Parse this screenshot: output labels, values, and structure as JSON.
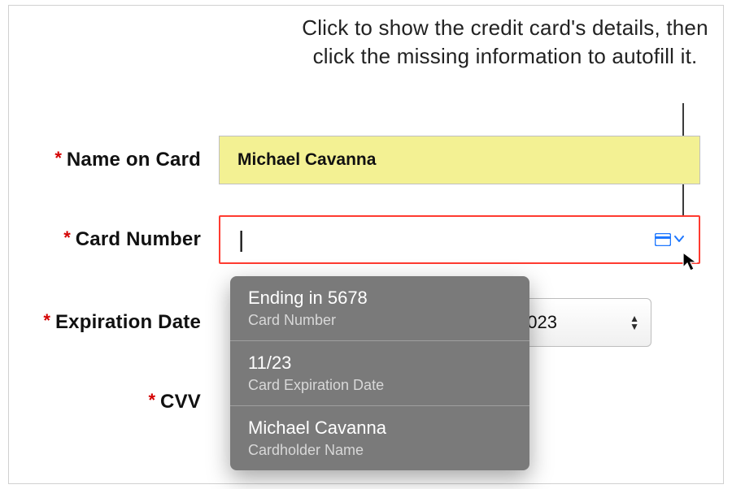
{
  "callout": "Click to show the credit card's details, then click the missing information to autofill it.",
  "labels": {
    "name_on_card": "Name on Card",
    "card_number": "Card Number",
    "expiration_date": "Expiration Date",
    "cvv": "CVV",
    "required_mark": "*"
  },
  "fields": {
    "name_on_card_value": "Michael Cavanna",
    "card_number_value": "",
    "card_number_caret": "|",
    "expiration_year": "2023"
  },
  "autofill_dropdown": [
    {
      "main": "Ending in 5678",
      "sub": "Card Number"
    },
    {
      "main": "11/23",
      "sub": "Card Expiration Date"
    },
    {
      "main": "Michael Cavanna",
      "sub": "Cardholder Name"
    }
  ],
  "icons": {
    "credit_card": "credit-card-icon",
    "chevron_down": "chevron-down-icon",
    "updown": "updown-stepper-icon",
    "cursor": "cursor-icon"
  },
  "colors": {
    "highlight_bg": "#f3f193",
    "focus_border": "#ff3b30",
    "accent": "#1f78ff",
    "required": "#d40000",
    "dropdown_bg": "#7a7a7a"
  }
}
